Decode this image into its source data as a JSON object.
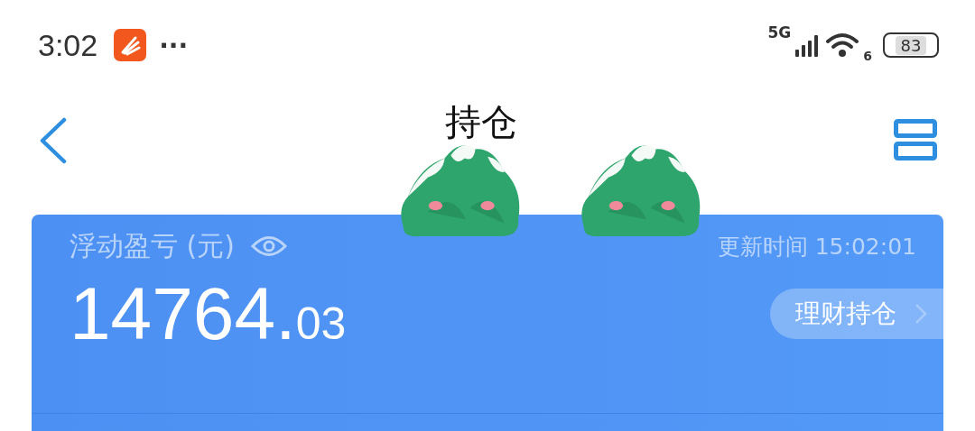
{
  "status_bar": {
    "time": "3:02",
    "more": "···",
    "network": "5G",
    "wifi_label": "6",
    "battery": "83"
  },
  "header": {
    "title": "持仓"
  },
  "summary": {
    "label": "浮动盈亏 (元)",
    "updated": "更新时间 15:02:01",
    "amount_integer": "14764.",
    "amount_decimal": "03",
    "link": "理财持仓"
  }
}
